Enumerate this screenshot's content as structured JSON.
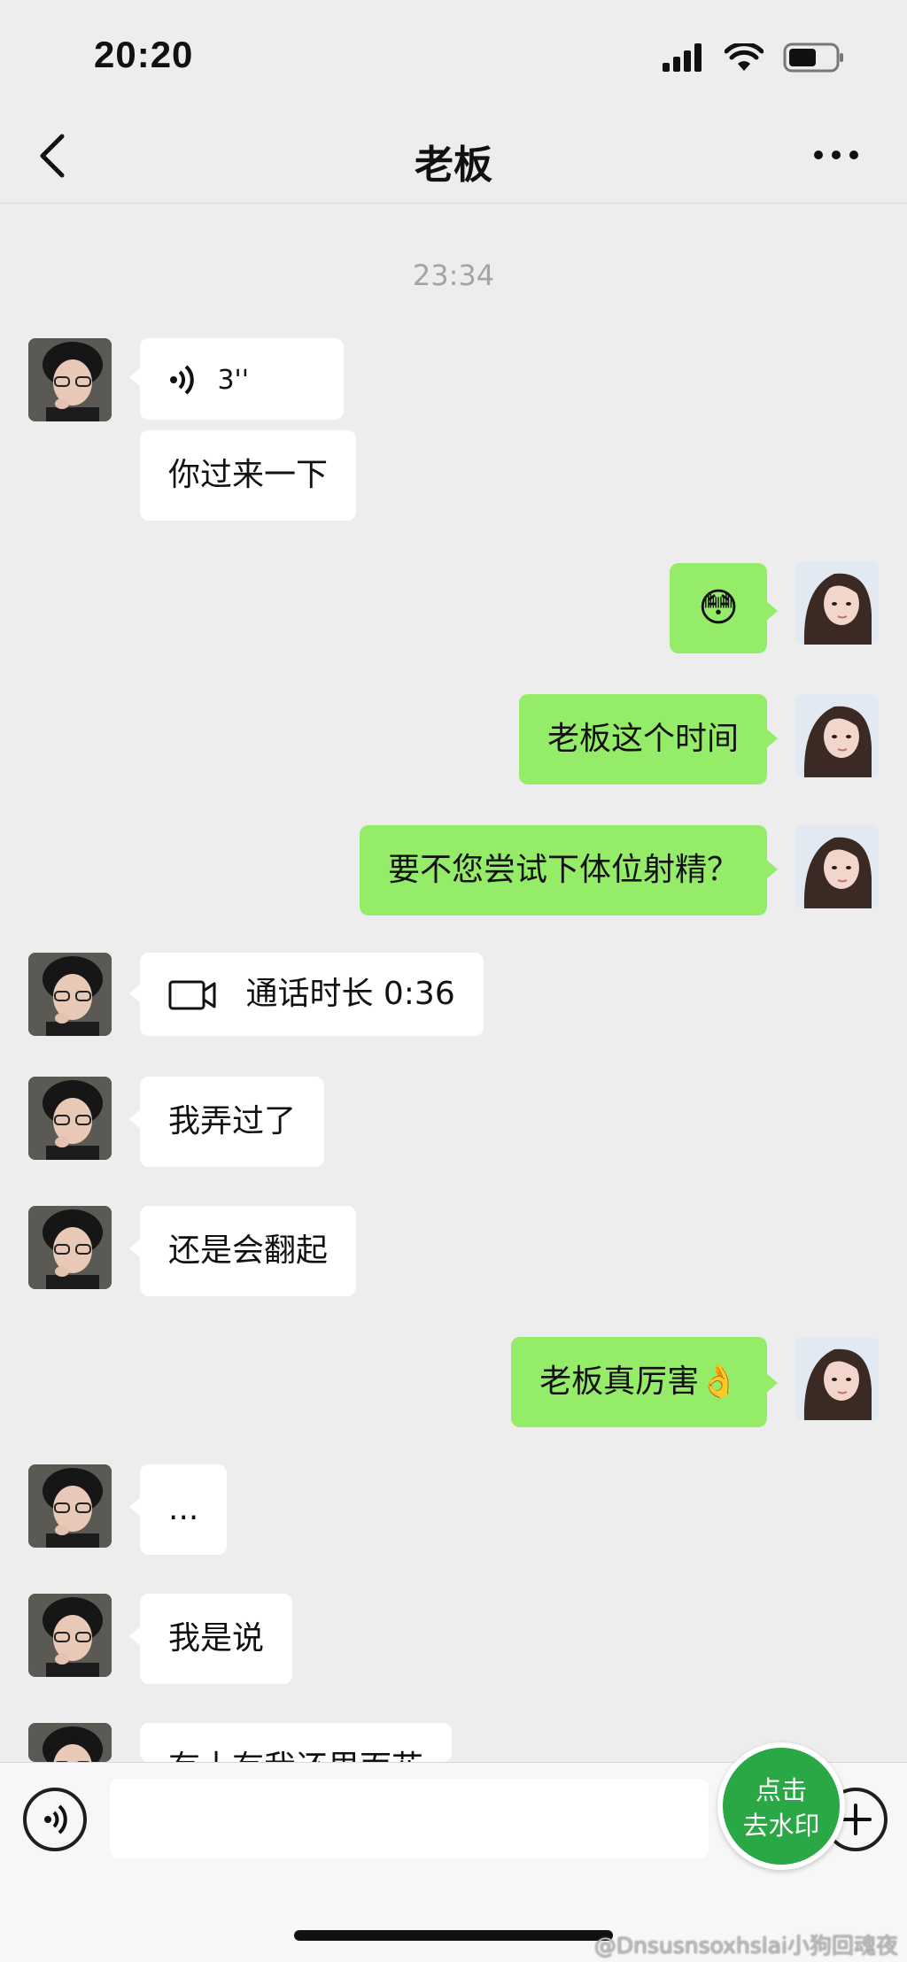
{
  "status_bar": {
    "time": "20:20"
  },
  "nav": {
    "title": "老板"
  },
  "chat": {
    "timestamp": "23:34",
    "messages": [
      {
        "side": "left",
        "type": "voice",
        "duration": "3''"
      },
      {
        "side": "left",
        "type": "text",
        "text": "你过来一下"
      },
      {
        "side": "right",
        "type": "emoji",
        "text": "😳"
      },
      {
        "side": "right",
        "type": "text",
        "text": "老板这个时间"
      },
      {
        "side": "right",
        "type": "text",
        "text": "要不您尝试下体位射精？"
      },
      {
        "side": "left",
        "type": "video_call",
        "text": "通话时长 0:36"
      },
      {
        "side": "left",
        "type": "text",
        "text": "我弄过了"
      },
      {
        "side": "left",
        "type": "text",
        "text": "还是会翻起"
      },
      {
        "side": "right",
        "type": "text",
        "text": "老板真厉害👌"
      },
      {
        "side": "left",
        "type": "text",
        "text": "..."
      },
      {
        "side": "left",
        "type": "text",
        "text": "我是说"
      },
      {
        "side": "left",
        "type": "text",
        "text": "有十有我还里面花"
      }
    ]
  },
  "input_bar": {
    "placeholder": ""
  },
  "watermark_button": {
    "line1": "点击",
    "line2": "去水印"
  },
  "credit": "@Dnsusnsoxhslai小狗回魂夜",
  "colors": {
    "background": "#ededed",
    "outgoing_bubble": "#95ec69",
    "incoming_bubble": "#ffffff",
    "watermark_button": "#2aa845"
  },
  "icons": {
    "back": "chevron-left-icon",
    "more": "ellipsis-icon",
    "voice": "voice-wave-icon",
    "video": "video-camera-icon",
    "plus": "plus-circle-icon"
  }
}
